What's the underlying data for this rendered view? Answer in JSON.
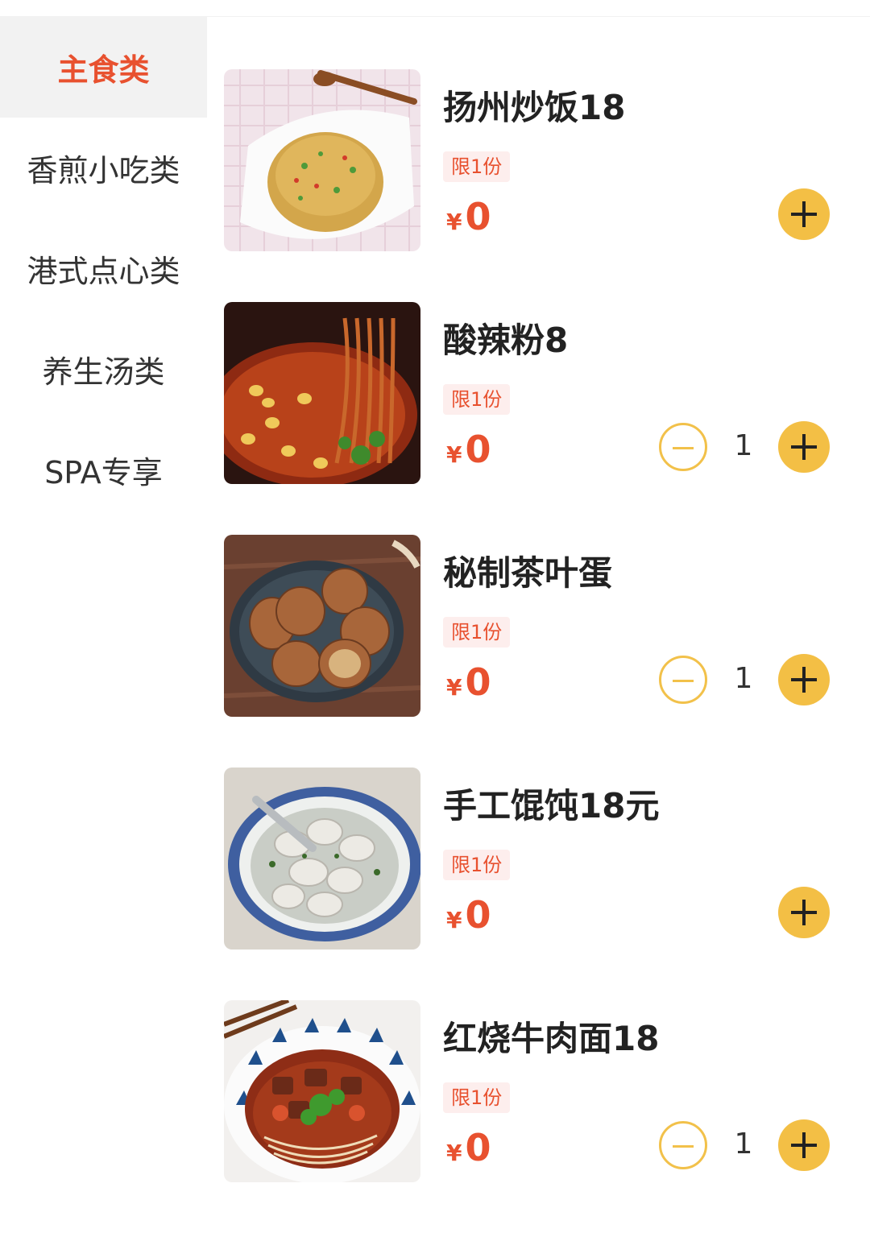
{
  "categories": [
    {
      "label": "主食类",
      "active": true
    },
    {
      "label": "香煎小吃类",
      "active": false
    },
    {
      "label": "港式点心类",
      "active": false
    },
    {
      "label": "养生汤类",
      "active": false
    },
    {
      "label": "SPA专享",
      "active": false
    }
  ],
  "items": [
    {
      "name": "扬州炒饭18",
      "limit": "限1份",
      "currency": "¥",
      "price": "0",
      "quantity": null,
      "image": "fried-rice-photo"
    },
    {
      "name": "酸辣粉8",
      "limit": "限1份",
      "currency": "¥",
      "price": "0",
      "quantity": "1",
      "image": "hot-sour-noodles-photo"
    },
    {
      "name": "秘制茶叶蛋",
      "limit": "限1份",
      "currency": "¥",
      "price": "0",
      "quantity": "1",
      "image": "tea-eggs-photo"
    },
    {
      "name": "手工馄饨18元",
      "limit": "限1份",
      "currency": "¥",
      "price": "0",
      "quantity": null,
      "image": "wonton-soup-photo"
    },
    {
      "name": "红烧牛肉面18",
      "limit": "限1份",
      "currency": "¥",
      "price": "0",
      "quantity": "1",
      "image": "beef-noodle-photo"
    }
  ],
  "colors": {
    "accent": "#e8512f",
    "button": "#f3bf45",
    "active_bg": "#f2f2f2"
  }
}
